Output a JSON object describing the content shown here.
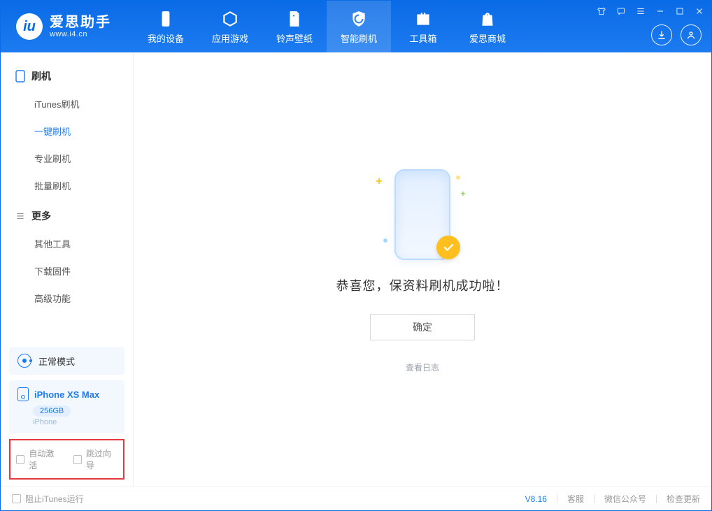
{
  "app": {
    "title": "爱思助手",
    "subtitle": "www.i4.cn"
  },
  "tabs": [
    {
      "id": "device",
      "label": "我的设备"
    },
    {
      "id": "apps",
      "label": "应用游戏"
    },
    {
      "id": "ringtone",
      "label": "铃声壁纸"
    },
    {
      "id": "flash",
      "label": "智能刷机",
      "active": true
    },
    {
      "id": "toolbox",
      "label": "工具箱"
    },
    {
      "id": "store",
      "label": "爱思商城"
    }
  ],
  "sidebar": {
    "section1": {
      "title": "刷机",
      "items": [
        {
          "id": "itunes",
          "label": "iTunes刷机"
        },
        {
          "id": "oneclick",
          "label": "一键刷机",
          "active": true
        },
        {
          "id": "pro",
          "label": "专业刷机"
        },
        {
          "id": "batch",
          "label": "批量刷机"
        }
      ]
    },
    "section2": {
      "title": "更多",
      "items": [
        {
          "id": "othertools",
          "label": "其他工具"
        },
        {
          "id": "firmware",
          "label": "下载固件"
        },
        {
          "id": "advanced",
          "label": "高级功能"
        }
      ]
    },
    "status_mode": "正常模式",
    "device": {
      "name": "iPhone XS Max",
      "capacity": "256GB",
      "type": "iPhone"
    },
    "checkbox1": "自动激活",
    "checkbox2": "跳过向导"
  },
  "main": {
    "success_text": "恭喜您，保资料刷机成功啦！",
    "ok_button": "确定",
    "view_log": "查看日志"
  },
  "footer": {
    "block_itunes": "阻止iTunes运行",
    "version": "V8.16",
    "links": [
      "客服",
      "微信公众号",
      "检查更新"
    ]
  }
}
